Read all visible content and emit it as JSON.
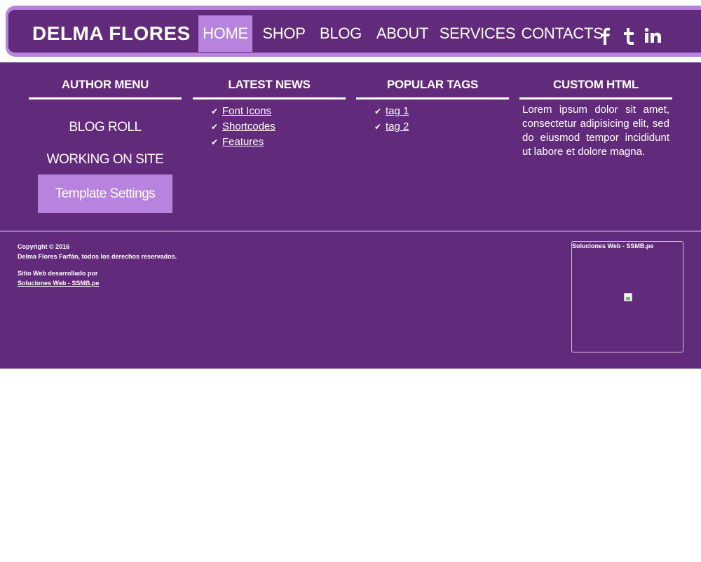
{
  "header": {
    "site_title": "DELMA FLORES",
    "nav": [
      {
        "label": "HOME",
        "active": true
      },
      {
        "label": "SHOP",
        "active": false
      },
      {
        "label": "BLOG",
        "active": false
      },
      {
        "label": "ABOUT",
        "active": false
      },
      {
        "label": "SERVICES",
        "active": false
      },
      {
        "label": "CONTACTS",
        "active": false
      }
    ],
    "social": [
      {
        "icon": "facebook-icon",
        "glyph": "f"
      },
      {
        "icon": "tumblr-icon",
        "glyph": "t"
      },
      {
        "icon": "linkedin-icon",
        "glyph": "in"
      }
    ]
  },
  "widgets": {
    "author_menu": {
      "title": "AUTHOR MENU",
      "links": [
        "BLOG ROLL",
        "WORKING ON SITE"
      ],
      "button": "Template Settings"
    },
    "latest_news": {
      "title": "LATEST NEWS",
      "items": [
        "Font Icons",
        "Shortcodes",
        "Features"
      ]
    },
    "popular_tags": {
      "title": "POPULAR TAGS",
      "items": [
        "tag 1",
        "tag 2"
      ]
    },
    "custom_html": {
      "title": "CUSTOM HTML",
      "text": "Lorem ipsum dolor sit amet, consectetur adipisicing elit, sed do eiusmod tempor incididunt ut labore et dolore magna."
    }
  },
  "footer": {
    "copyright_line1": "Copyright © 2016",
    "copyright_line2": "Delma Flores Farfán, todos los derechos reservados.",
    "dev_label": "Sitio Web desarrollado por",
    "dev_link": "Soluciones Web - SSMB.pe",
    "box_title": "Soluciones Web - SSMB.pe"
  },
  "colors": {
    "primary": "#622a7a",
    "accent": "#b783de",
    "text": "#ffffff"
  }
}
